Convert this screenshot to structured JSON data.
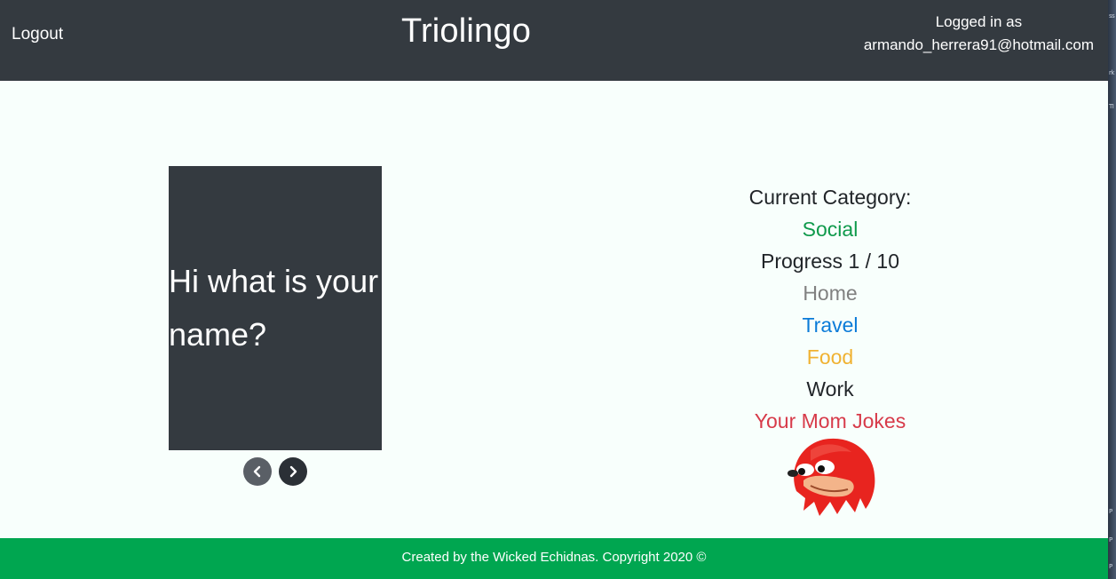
{
  "header": {
    "logout_label": "Logout",
    "brand": "Triolingo",
    "logged_in_label": "Logged in as",
    "user_email": "armando_herrera91@hotmail.com"
  },
  "flashcard": {
    "text": "Hi what is your name?",
    "prev_icon": "chevron-left-icon",
    "next_icon": "chevron-right-icon"
  },
  "categories": {
    "heading": "Current Category:",
    "current": "Social",
    "progress": "Progress 1 / 10",
    "progress_value": 0.1,
    "items": [
      {
        "label": "Home",
        "color": "#808080"
      },
      {
        "label": "Travel",
        "color": "#0b7bd8"
      },
      {
        "label": "Food",
        "color": "#f0b232"
      },
      {
        "label": "Work",
        "color": "#212529"
      },
      {
        "label": "Your Mom Jokes",
        "color": "#d73a49"
      }
    ]
  },
  "footer": {
    "text": "Created by the Wicked Echidnas. Copyright 2020 ©"
  },
  "colors": {
    "navbar": "#343a40",
    "footer": "#00a650",
    "background": "#f8fffc",
    "accent_current": "#109a4c"
  }
}
